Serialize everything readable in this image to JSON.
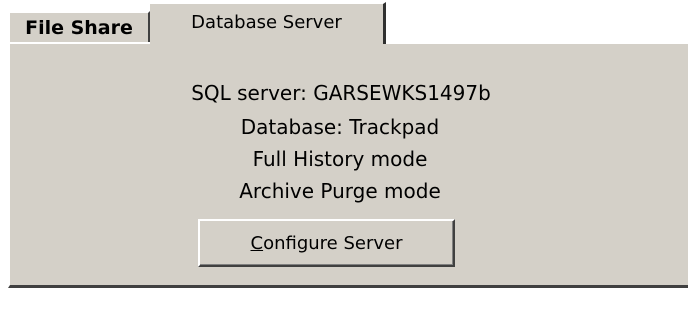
{
  "tabs": [
    {
      "label": "File Share",
      "selected": false
    },
    {
      "label": "Database Server",
      "selected": true
    }
  ],
  "server_info": {
    "sql_server": "SQL server:  GARSEWKS1497b",
    "database": "Database: Trackpad",
    "history_mode": "Full History mode",
    "archive_mode": "Archive Purge mode"
  },
  "configure_button": {
    "label_accel": "C",
    "label_rest": "onfigure Server"
  },
  "colors": {
    "face": "#d4d0c8",
    "highlight": "#ffffff",
    "shadow": "#404040"
  }
}
